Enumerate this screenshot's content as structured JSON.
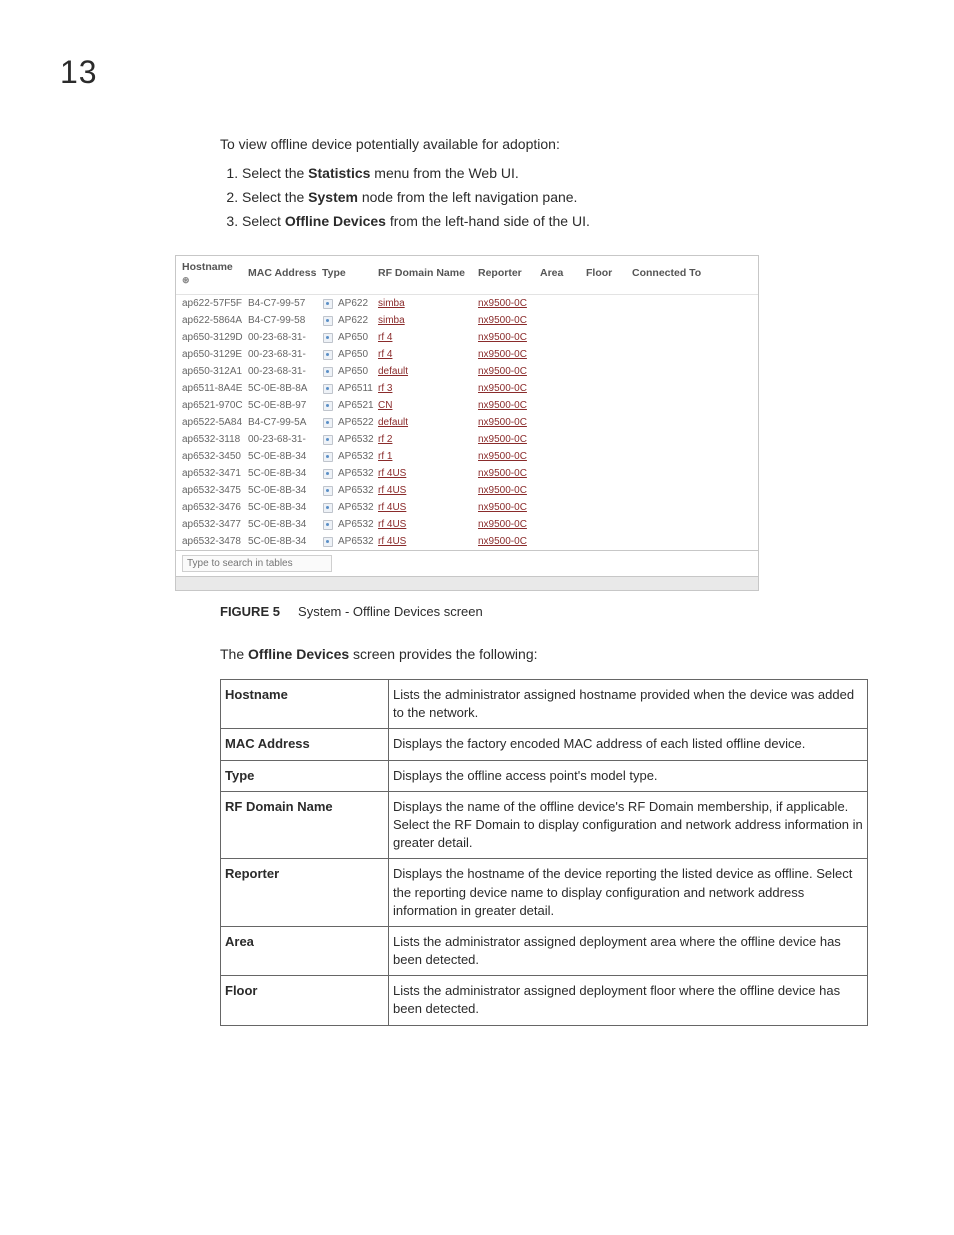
{
  "chapter_number": "13",
  "intro_text": "To view offline device potentially available for adoption:",
  "steps": [
    {
      "pre": "Select the ",
      "bold": "Statistics",
      "post": " menu from the Web UI."
    },
    {
      "pre": "Select the ",
      "bold": "System",
      "post": " node from the left navigation pane."
    },
    {
      "pre": "Select ",
      "bold": "Offline Devices",
      "post": " from the left-hand side of the UI."
    }
  ],
  "grid": {
    "headers": [
      "Hostname",
      "MAC Address",
      "Type",
      "RF Domain Name",
      "Reporter",
      "Area",
      "Floor",
      "Connected To"
    ],
    "sort_glyph": "⊛",
    "rows": [
      {
        "host": "ap622-57F5F",
        "mac": "B4-C7-99-57",
        "type": "AP622",
        "rf": "simba",
        "rep": "nx9500-0C"
      },
      {
        "host": "ap622-5864A",
        "mac": "B4-C7-99-58",
        "type": "AP622",
        "rf": "simba",
        "rep": "nx9500-0C"
      },
      {
        "host": "ap650-3129D",
        "mac": "00-23-68-31-",
        "type": "AP650",
        "rf": "rf 4",
        "rep": "nx9500-0C"
      },
      {
        "host": "ap650-3129E",
        "mac": "00-23-68-31-",
        "type": "AP650",
        "rf": "rf 4",
        "rep": "nx9500-0C"
      },
      {
        "host": "ap650-312A1",
        "mac": "00-23-68-31-",
        "type": "AP650",
        "rf": "default",
        "rep": "nx9500-0C"
      },
      {
        "host": "ap6511-8A4E",
        "mac": "5C-0E-8B-8A",
        "type": "AP6511",
        "rf": "rf 3",
        "rep": "nx9500-0C"
      },
      {
        "host": "ap6521-970C",
        "mac": "5C-0E-8B-97",
        "type": "AP6521",
        "rf": "CN",
        "rep": "nx9500-0C"
      },
      {
        "host": "ap6522-5A84",
        "mac": "B4-C7-99-5A",
        "type": "AP6522",
        "rf": "default",
        "rep": "nx9500-0C"
      },
      {
        "host": "ap6532-3118",
        "mac": "00-23-68-31-",
        "type": "AP6532",
        "rf": "rf 2",
        "rep": "nx9500-0C"
      },
      {
        "host": "ap6532-3450",
        "mac": "5C-0E-8B-34",
        "type": "AP6532",
        "rf": "rf 1",
        "rep": "nx9500-0C"
      },
      {
        "host": "ap6532-3471",
        "mac": "5C-0E-8B-34",
        "type": "AP6532",
        "rf": "rf 4US",
        "rep": "nx9500-0C"
      },
      {
        "host": "ap6532-3475",
        "mac": "5C-0E-8B-34",
        "type": "AP6532",
        "rf": "rf 4US",
        "rep": "nx9500-0C"
      },
      {
        "host": "ap6532-3476",
        "mac": "5C-0E-8B-34",
        "type": "AP6532",
        "rf": "rf 4US",
        "rep": "nx9500-0C"
      },
      {
        "host": "ap6532-3477",
        "mac": "5C-0E-8B-34",
        "type": "AP6532",
        "rf": "rf 4US",
        "rep": "nx9500-0C"
      },
      {
        "host": "ap6532-3478",
        "mac": "5C-0E-8B-34",
        "type": "AP6532",
        "rf": "rf 4US",
        "rep": "nx9500-0C"
      }
    ],
    "search_placeholder": "Type to search in tables"
  },
  "figure": {
    "label": "FIGURE 5",
    "caption": "System - Offline Devices screen"
  },
  "desc_intro": {
    "pre": "The ",
    "bold": "Offline Devices",
    "post": " screen provides the following:"
  },
  "definitions": [
    {
      "term": "Hostname",
      "text": "Lists the administrator assigned hostname provided when the device was added to the  network."
    },
    {
      "term": "MAC Address",
      "text": "Displays the factory encoded MAC address of each listed offline device."
    },
    {
      "term": "Type",
      "text": "Displays the offline access point's model type."
    },
    {
      "term": "RF Domain Name",
      "text": "Displays the name of the offline device's RF Domain membership, if applicable. Select the RF Domain to display configuration and network address information in greater detail."
    },
    {
      "term": "Reporter",
      "text": "Displays the hostname of the device reporting the listed device as offline. Select the reporting device name to display configuration and network address information in greater detail."
    },
    {
      "term": "Area",
      "text": "Lists the administrator assigned deployment area where the offline device has been detected."
    },
    {
      "term": "Floor",
      "text": "Lists the administrator assigned deployment floor where the offline device has been detected."
    }
  ]
}
